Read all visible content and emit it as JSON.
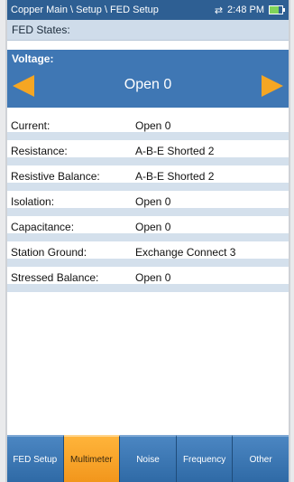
{
  "status_bar": {
    "breadcrumb": "Copper Main \\ Setup \\ FED Setup",
    "time": "2:48 PM",
    "sync_icon": "sync-arrows-icon",
    "battery_icon": "battery-icon"
  },
  "section": {
    "fed_states_label": "FED States:"
  },
  "voltage": {
    "label": "Voltage:",
    "value": "Open 0"
  },
  "rows": [
    {
      "label": "Current:",
      "value": "Open 0"
    },
    {
      "label": "Resistance:",
      "value": "A-B-E Shorted 2"
    },
    {
      "label": "Resistive Balance:",
      "value": "A-B-E Shorted 2"
    },
    {
      "label": "Isolation:",
      "value": "Open 0"
    },
    {
      "label": "Capacitance:",
      "value": "Open 0"
    },
    {
      "label": "Station Ground:",
      "value": "Exchange Connect 3"
    },
    {
      "label": "Stressed Balance:",
      "value": "Open 0"
    }
  ],
  "tabs": [
    {
      "label": "FED Setup",
      "active": false
    },
    {
      "label": "Multimeter",
      "active": true
    },
    {
      "label": "Noise",
      "active": false
    },
    {
      "label": "Frequency",
      "active": false
    },
    {
      "label": "Other",
      "active": false
    }
  ],
  "colors": {
    "header_blue": "#2e5f93",
    "voltage_blue": "#3f77b4",
    "arrow_orange": "#f5a623",
    "active_tab_orange": "#f2961c",
    "row_band": "#d4e0ec"
  }
}
